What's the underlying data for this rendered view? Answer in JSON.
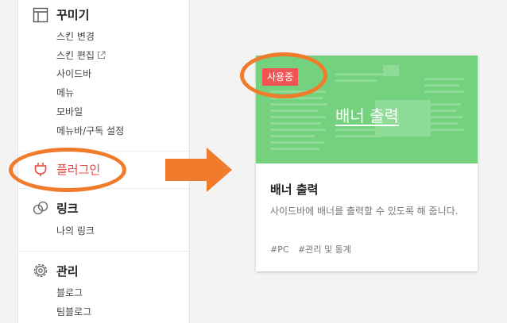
{
  "sidebar": {
    "decorate": {
      "title": "꾸미기",
      "items": [
        "스킨 변경",
        "스킨 편집",
        "사이드바",
        "메뉴",
        "모바일",
        "메뉴바/구독 설정"
      ]
    },
    "plugin": {
      "title": "플러그인"
    },
    "link": {
      "title": "링크",
      "items": [
        "나의 링크"
      ]
    },
    "manage": {
      "title": "관리",
      "items": [
        "블로그",
        "팀블로그"
      ]
    }
  },
  "plugin_card": {
    "badge": "사용중",
    "thumb_title": "배너 출력",
    "title": "배너 출력",
    "description": "사이드바에 배너를 출력할 수 있도록 해 줍니다.",
    "tags": [
      "#PC",
      "#관리 및 통계"
    ]
  },
  "colors": {
    "accent_orange": "#f07c2b",
    "active_red": "#e8483f",
    "thumbnail_green": "#74d27f",
    "badge_red": "#f05454"
  }
}
